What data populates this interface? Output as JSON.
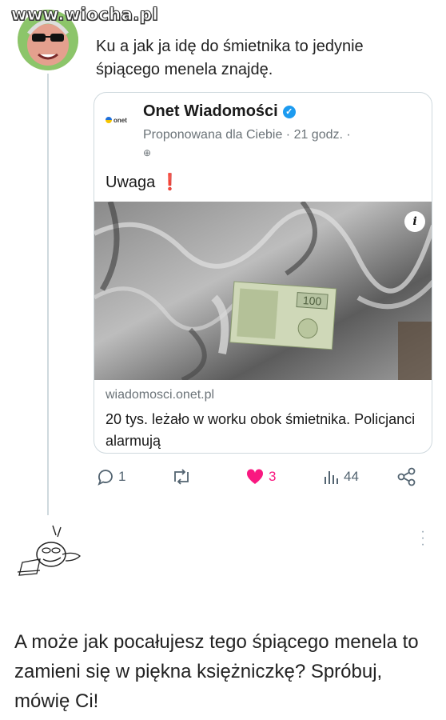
{
  "watermark": "www.wiocha.pl",
  "tweet": {
    "text": "Ku     a jak ja idę do śmietnika to jedynie śpiącego menela znajdę."
  },
  "card": {
    "source_name": "Onet Wiadomości",
    "logo_text": "onet",
    "meta": "Proponowana dla Ciebie · 21 godz. · ",
    "post_text": "Uwaga",
    "exclamation": "❗",
    "banknote_value": "100",
    "link_domain": "wiadomosci.onet.pl",
    "link_title": "20 tys. leżało w worku obok śmietnika. Policjanci alarmują"
  },
  "actions": {
    "reply_count": "1",
    "repost_count": "",
    "like_count": "3",
    "views_count": "44"
  },
  "reply": {
    "text": "A może jak pocałujesz tego śpiącego menela to zamieni się w piękna księżniczkę? Spróbuj, mówię Ci!"
  },
  "colors": {
    "like": "#f91880",
    "verified": "#1d9bf0",
    "muted": "#536471"
  }
}
